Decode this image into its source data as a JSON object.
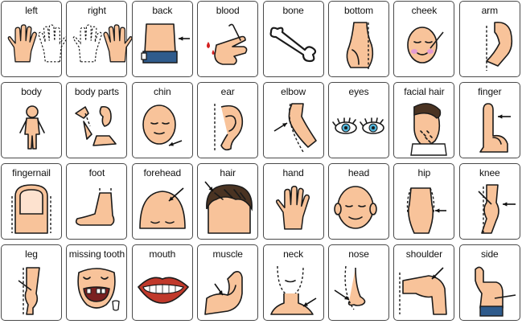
{
  "board": {
    "cards": [
      {
        "label": "left",
        "icon": "left-hand-icon"
      },
      {
        "label": "right",
        "icon": "right-hand-icon"
      },
      {
        "label": "back",
        "icon": "back-icon"
      },
      {
        "label": "blood",
        "icon": "blood-icon"
      },
      {
        "label": "bone",
        "icon": "bone-icon"
      },
      {
        "label": "bottom",
        "icon": "bottom-icon"
      },
      {
        "label": "cheek",
        "icon": "cheek-icon"
      },
      {
        "label": "arm",
        "icon": "arm-icon"
      },
      {
        "label": "body",
        "icon": "body-icon"
      },
      {
        "label": "body parts",
        "icon": "body-parts-icon"
      },
      {
        "label": "chin",
        "icon": "chin-icon"
      },
      {
        "label": "ear",
        "icon": "ear-icon"
      },
      {
        "label": "elbow",
        "icon": "elbow-icon"
      },
      {
        "label": "eyes",
        "icon": "eyes-icon"
      },
      {
        "label": "facial hair",
        "icon": "facial-hair-icon"
      },
      {
        "label": "finger",
        "icon": "finger-icon"
      },
      {
        "label": "fingernail",
        "icon": "fingernail-icon"
      },
      {
        "label": "foot",
        "icon": "foot-icon"
      },
      {
        "label": "forehead",
        "icon": "forehead-icon"
      },
      {
        "label": "hair",
        "icon": "hair-icon"
      },
      {
        "label": "hand",
        "icon": "hand-icon"
      },
      {
        "label": "head",
        "icon": "head-icon"
      },
      {
        "label": "hip",
        "icon": "hip-icon"
      },
      {
        "label": "knee",
        "icon": "knee-icon"
      },
      {
        "label": "leg",
        "icon": "leg-icon"
      },
      {
        "label": "missing tooth",
        "icon": "missing-tooth-icon"
      },
      {
        "label": "mouth",
        "icon": "mouth-icon"
      },
      {
        "label": "muscle",
        "icon": "muscle-icon"
      },
      {
        "label": "neck",
        "icon": "neck-icon"
      },
      {
        "label": "nose",
        "icon": "nose-icon"
      },
      {
        "label": "shoulder",
        "icon": "shoulder-icon"
      },
      {
        "label": "side",
        "icon": "side-icon"
      }
    ]
  },
  "colors": {
    "skin": "#f8c39a",
    "outline": "#1a1a1a",
    "card_border": "#4a4a4a",
    "arrow": "#111111",
    "eye_blue": "#4fb3d9",
    "jeans": "#2f5b8c",
    "hair": "#4a3322",
    "lips": "#c0392b",
    "blood": "#d42020"
  }
}
